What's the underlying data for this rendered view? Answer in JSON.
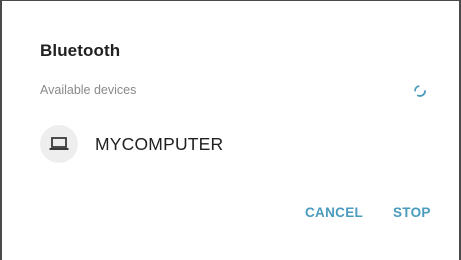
{
  "dialog": {
    "title": "Bluetooth",
    "section_header": "Available devices",
    "spinner_icon": "loading-spinner-icon",
    "devices": [
      {
        "name": "MYCOMPUTER",
        "icon": "laptop-icon"
      }
    ],
    "buttons": {
      "cancel_label": "CANCEL",
      "stop_label": "STOP"
    }
  },
  "colors": {
    "accent": "#4a9bbd",
    "title_text": "#212121",
    "secondary_text": "#8a8a8a",
    "icon_background": "#eeeeee",
    "frame_border": "#4a4a4a"
  }
}
